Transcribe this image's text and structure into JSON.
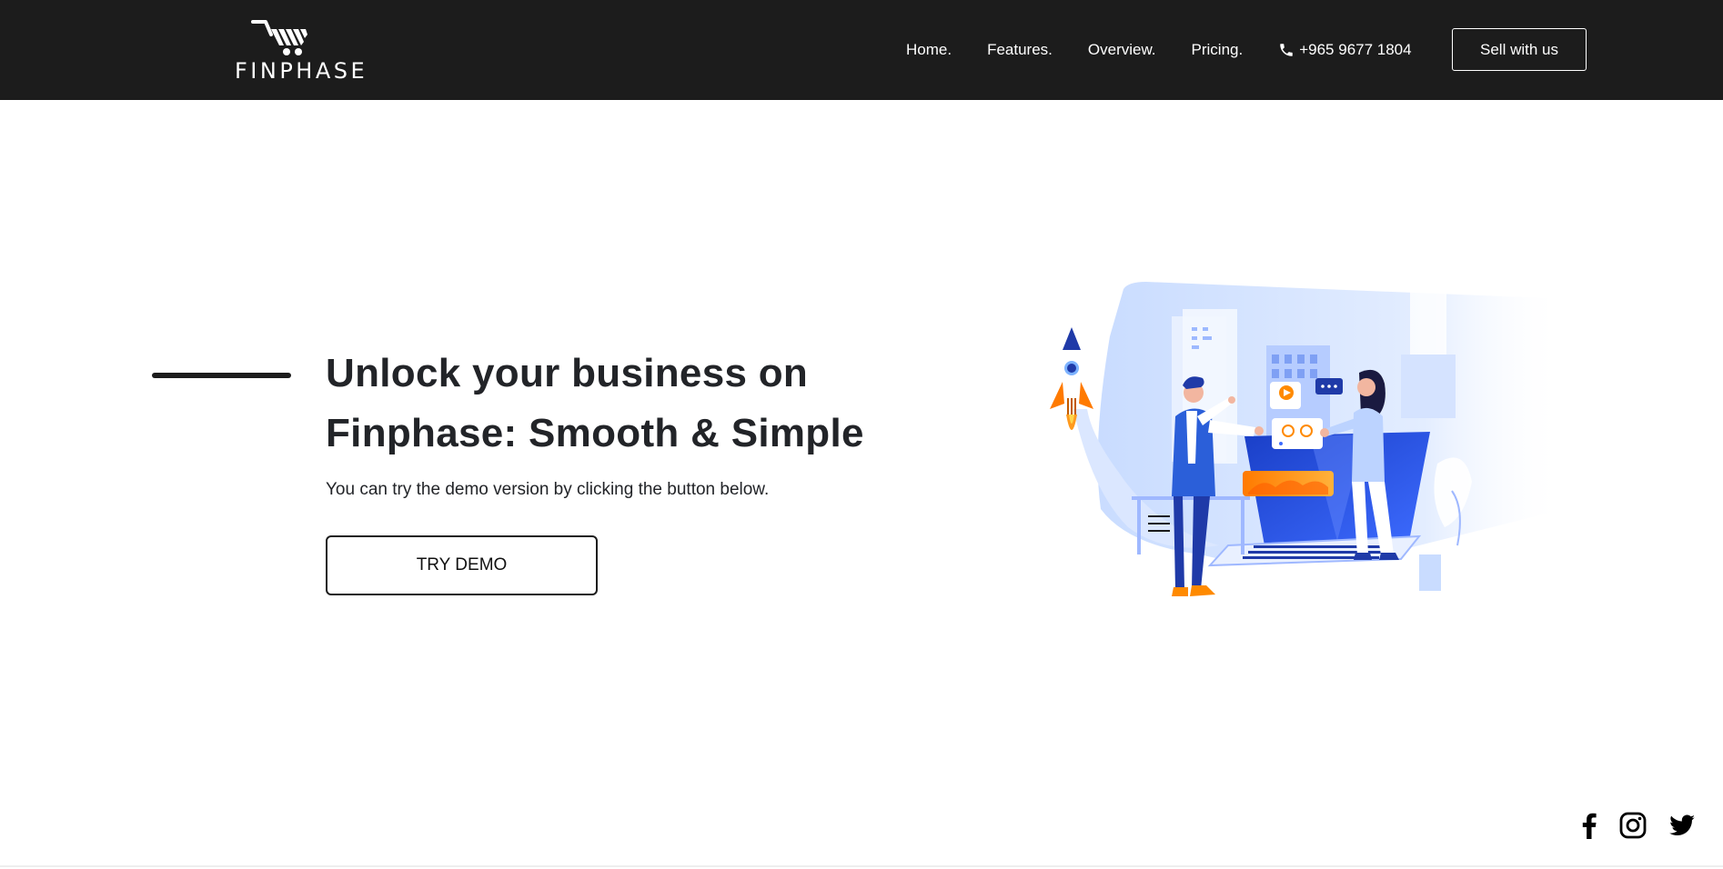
{
  "brand": {
    "name": "FINPHASE",
    "logo_icon": "shopping-cart-icon"
  },
  "nav": {
    "items": [
      {
        "label": "Home."
      },
      {
        "label": "Features."
      },
      {
        "label": "Overview."
      },
      {
        "label": "Pricing."
      }
    ],
    "phone": {
      "icon": "phone-icon",
      "number": "+965 9677 1804"
    },
    "cta_label": "Sell with us"
  },
  "hero": {
    "title": "Unlock your business on Finphase: Smooth & Simple",
    "subtitle": "You can try the demo version by clicking the button below.",
    "button_label": "TRY DEMO"
  },
  "social": {
    "icons": [
      "facebook-icon",
      "instagram-icon",
      "twitter-icon"
    ]
  },
  "colors": {
    "header_bg": "#1c1c1c",
    "text_dark": "#222428",
    "accent_blue": "#2b5fd9",
    "accent_orange": "#ff8a00"
  }
}
